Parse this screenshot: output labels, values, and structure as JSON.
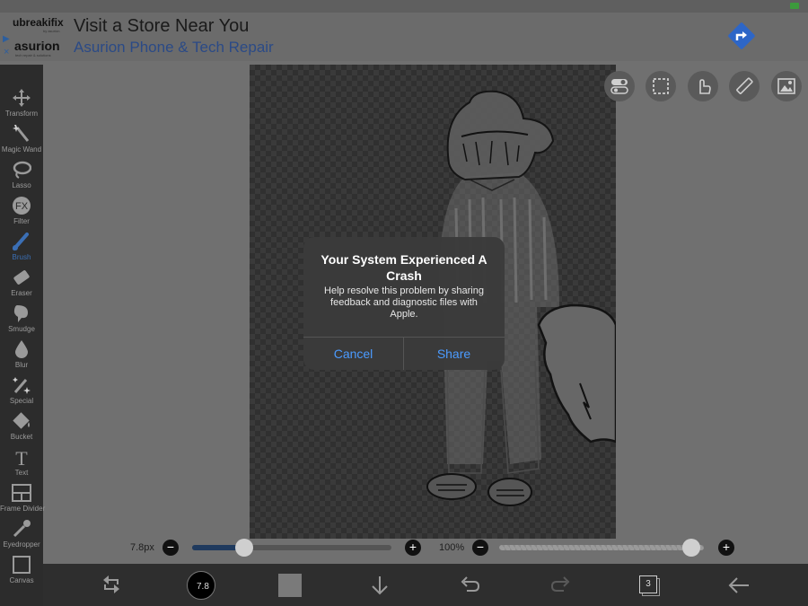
{
  "ad": {
    "brand1": "ubreakifix",
    "brand1_sub": "by asurion",
    "brand2": "asurion",
    "brand2_sub": "tech repair & solutions",
    "headline": "Visit a Store Near You",
    "subline": "Asurion Phone & Tech Repair",
    "adchoices_icon": "play-triangle-icon",
    "close_glyph": "×",
    "arrow_icon": "turn-right-arrow-icon",
    "arrow_color": "#2d66c7"
  },
  "tools": [
    {
      "label": "Transform",
      "icon": "move-arrows-icon"
    },
    {
      "label": "Magic Wand",
      "icon": "magic-wand-icon"
    },
    {
      "label": "Lasso",
      "icon": "lasso-icon"
    },
    {
      "label": "Filter",
      "icon": "fx-icon",
      "glyph": "FX"
    },
    {
      "label": "Brush",
      "icon": "brush-icon",
      "active": true
    },
    {
      "label": "Eraser",
      "icon": "eraser-icon"
    },
    {
      "label": "Smudge",
      "icon": "smudge-icon"
    },
    {
      "label": "Blur",
      "icon": "drop-icon"
    },
    {
      "label": "Special",
      "icon": "sparkle-pen-icon"
    },
    {
      "label": "Bucket",
      "icon": "bucket-icon"
    },
    {
      "label": "Text",
      "icon": "text-icon",
      "glyph": "T"
    },
    {
      "label": "Frame Divider",
      "icon": "frame-divider-icon"
    },
    {
      "label": "Eyedropper",
      "icon": "eyedropper-icon"
    },
    {
      "label": "Canvas",
      "icon": "canvas-icon"
    }
  ],
  "top_buttons": [
    "toggle-icon",
    "selection-icon",
    "hand-icon",
    "ruler-icon",
    "image-icon"
  ],
  "brush_size": {
    "label": "7.8px",
    "minus": "−",
    "plus": "+",
    "value_fraction": 0.26
  },
  "opacity": {
    "label": "100%",
    "minus": "−",
    "plus": "+",
    "value_fraction": 1.0
  },
  "bottom_bar": {
    "color_button_value": "7.8",
    "layers_count": "3"
  },
  "dialog": {
    "title": "Your System Experienced A Crash",
    "message": "Help resolve this problem by sharing feedback and diagnostic files with Apple.",
    "cancel": "Cancel",
    "share": "Share",
    "button_color": "#4b9bff"
  },
  "colors": {
    "sidebar_bg": "#2c2c2c",
    "active_tool": "#3b6fb5",
    "slider_fill": "#1f3a5e"
  }
}
